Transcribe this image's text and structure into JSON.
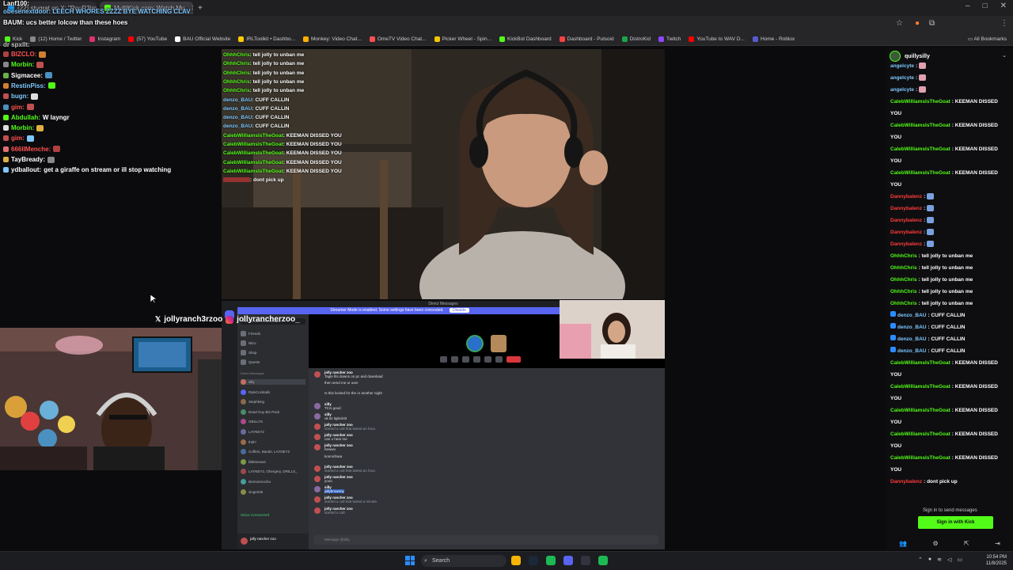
{
  "browser": {
    "tabs": [
      {
        "label": "(22) stugrat on X: \"RouR3im h",
        "color": "#1d9bf0"
      },
      {
        "label": "MultiKick.com: Watch Mu",
        "color": "#53fc18"
      }
    ],
    "new_tab": "+",
    "window_controls": [
      "–",
      "□",
      "✕"
    ],
    "bookmarks": [
      {
        "label": "Kick",
        "color": "#53fc18"
      },
      {
        "label": "(12) Home / Twitter",
        "color": "#888888"
      },
      {
        "label": "Instagram",
        "color": "#e1306c"
      },
      {
        "label": "(57) YouTube",
        "color": "#ff0000"
      },
      {
        "label": "BAU Official Website",
        "color": "#ffffff"
      },
      {
        "label": "IRLToolkit • Dashbo...",
        "color": "#ffcc00"
      },
      {
        "label": "Monkey: Video Chat...",
        "color": "#ffb000"
      },
      {
        "label": "OmeTV Video Chat...",
        "color": "#ff5050"
      },
      {
        "label": "Picker Wheel - Spin...",
        "color": "#f5c400"
      },
      {
        "label": "KickBot Dashboard",
        "color": "#53fc18"
      },
      {
        "label": "Dashboard - Pulsoid",
        "color": "#ff4040"
      },
      {
        "label": "DistroKid",
        "color": "#1aa54b"
      },
      {
        "label": "Twitch",
        "color": "#9146ff"
      },
      {
        "label": "YouTube to WAV D...",
        "color": "#ff0000"
      },
      {
        "label": "Home - Roblox",
        "color": "#5a5ad0"
      }
    ],
    "all_bookmarks": "All Bookmarks"
  },
  "top_overlay": {
    "lines": [
      {
        "text": "Lanf100:",
        "color": "#ffffff"
      },
      {
        "text": "obesenextdoor: LEECH WHORES ZZZZ BYE WATCHING CLAV",
        "color": "#7ec8ff"
      },
      {
        "text": "BAUM: ucs better lolcow than these hoes",
        "color": "#ffffff"
      },
      {
        "text": "dr spxllt:",
        "color": "#c8c8c8"
      }
    ]
  },
  "left_chat": [
    {
      "user": "BIZCLO:",
      "color": "#ff5050",
      "text": ""
    },
    {
      "user": "Morbin:",
      "color": "#53fc18",
      "text": ""
    },
    {
      "user": "Sigmacee:",
      "color": "#ffffff",
      "text": ""
    },
    {
      "user": "RestinPiss:",
      "color": "#7ec8ff",
      "text": ""
    },
    {
      "user": "bugn:",
      "color": "#7ec8ff",
      "text": ""
    },
    {
      "user": "gim:",
      "color": "#ff5050",
      "text": ""
    },
    {
      "user": "Abdullah:",
      "color": "#53fc18",
      "text": "W layngr"
    },
    {
      "user": "Morbin:",
      "color": "#53fc18",
      "text": ""
    },
    {
      "user": "gim:",
      "color": "#ff5050",
      "text": ""
    },
    {
      "user": "666IIMenche:",
      "color": "#ff5050",
      "text": ""
    },
    {
      "user": "TayBready:",
      "color": "#ffffff",
      "text": ""
    },
    {
      "user": "ydballout:",
      "color": "#ffffff",
      "text": "get a giraffe on stream or ill stop watching"
    }
  ],
  "stream_chat": [
    {
      "user": "OhhhChris",
      "color": "#53fc18",
      "text": ": tell jolly to unban me"
    },
    {
      "user": "OhhhChris",
      "color": "#53fc18",
      "text": ": tell jolly to unban me"
    },
    {
      "user": "OhhhChris",
      "color": "#53fc18",
      "text": ": tell jolly to unban me"
    },
    {
      "user": "OhhhChris",
      "color": "#53fc18",
      "text": ": tell jolly to unban me"
    },
    {
      "user": "OhhhChris",
      "color": "#53fc18",
      "text": ": tell jolly to unban me"
    },
    {
      "user": "denzo_BAU",
      "color": "#7ec8ff",
      "text": ": CUFF CALLIN"
    },
    {
      "user": "denzo_BAU",
      "color": "#7ec8ff",
      "text": ": CUFF CALLIN"
    },
    {
      "user": "denzo_BAU",
      "color": "#7ec8ff",
      "text": ": CUFF CALLIN"
    },
    {
      "user": "denzo_BAU",
      "color": "#7ec8ff",
      "text": ": CUFF CALLIN"
    },
    {
      "user": "CalebWilliamsIsTheGoat",
      "color": "#53fc18",
      "text": ": KEEMAN DISSED YOU"
    },
    {
      "user": "CalebWilliamsIsTheGoat",
      "color": "#53fc18",
      "text": ": KEEMAN DISSED YOU"
    },
    {
      "user": "CalebWilliamsIsTheGoat",
      "color": "#53fc18",
      "text": ": KEEMAN DISSED YOU"
    },
    {
      "user": "CalebWilliamsIsTheGoat",
      "color": "#53fc18",
      "text": ": KEEMAN DISSED YOU"
    },
    {
      "user": "CalebWilliamsIsTheGoat",
      "color": "#53fc18",
      "text": ": KEEMAN DISSED YOU"
    },
    {
      "user": "",
      "color": "#ff3b3b",
      "text": ": dont pick up"
    }
  ],
  "discord": {
    "title": "Direct Messages",
    "banner": "Streamer Mode is enabled. Some settings have been concealed.",
    "banner_button": "Disable",
    "handle_x": "jollyranch3rzoo",
    "handle_ig": "jollyrancherzoo_",
    "search_placeholder": "Find or start a conversation",
    "sidebar": [
      "Friends",
      "Nitro",
      "Shop",
      "Quests"
    ],
    "dm_header": "Direct Messages",
    "dms": [
      "silly",
      "RyleCocktails",
      "Stephking",
      "Dead Guy Bin Pack",
      "GBILLY5",
      "LAYNEY2",
      "thdt?",
      "Cuffem, Bands, LAYNEY2",
      "bbbmeows",
      "LAYNEY2, Ghergery, DRILLS_",
      "Demonmocho",
      "singertok"
    ],
    "messages": [
      {
        "name": "jolly rancher zoo",
        "text": "Tagle fits downs on pc and download"
      },
      {
        "name": "",
        "text": "then send me ur user"
      },
      {
        "name": "",
        "text": "Is this locked for the or another night"
      },
      {
        "name": "silly",
        "text": "Tit is good"
      },
      {
        "name": "silly",
        "text": "ok its tiglecktit"
      },
      {
        "name": "jolly rancher zoo",
        "text": "started a call that lasted an hour."
      },
      {
        "name": "jolly rancher zoo",
        "text": "can u hear me"
      },
      {
        "name": "jolly rancher zoo",
        "text": "hewwo"
      },
      {
        "name": "",
        "text": "konnichiwa"
      },
      {
        "name": "jolly rancher zoo",
        "text": "started a call that lasted an hour."
      },
      {
        "name": "jolly rancher zoo",
        "text": "yooo"
      },
      {
        "name": "silly",
        "text": "jollybrownny"
      },
      {
        "name": "jolly rancher zoo",
        "text": "started a call that lasted a minute."
      },
      {
        "name": "jolly rancher zoo",
        "text": "started a call."
      }
    ],
    "user_name": "jolly rancher zoo",
    "voice_status": "Voice Connected",
    "message_placeholder": "Message @silly"
  },
  "right_chat": {
    "streamer": "quillysilly",
    "messages": [
      {
        "user": "angelcyte",
        "color": "#7ec8ff",
        "text": ""
      },
      {
        "user": "angelcyte",
        "color": "#7ec8ff",
        "text": ""
      },
      {
        "user": "angelcyte",
        "color": "#7ec8ff",
        "text": ""
      },
      {
        "user": "CalebWilliamsIsTheGoat",
        "color": "#53fc18",
        "text": "KEEMAN DISSED YOU"
      },
      {
        "user": "CalebWilliamsIsTheGoat",
        "color": "#53fc18",
        "text": "KEEMAN DISSED YOU"
      },
      {
        "user": "CalebWilliamsIsTheGoat",
        "color": "#53fc18",
        "text": "KEEMAN DISSED YOU"
      },
      {
        "user": "CalebWilliamsIsTheGoat",
        "color": "#53fc18",
        "text": "KEEMAN DISSED YOU"
      },
      {
        "user": "Dannybalenz",
        "color": "#ff3b3b",
        "text": ""
      },
      {
        "user": "Dannybalenz",
        "color": "#ff3b3b",
        "text": ""
      },
      {
        "user": "Dannybalenz",
        "color": "#ff3b3b",
        "text": ""
      },
      {
        "user": "Dannybalenz",
        "color": "#ff3b3b",
        "text": ""
      },
      {
        "user": "Dannybalenz",
        "color": "#ff3b3b",
        "text": ""
      },
      {
        "user": "OhhhChris",
        "color": "#53fc18",
        "text": "tell jolly to unban me"
      },
      {
        "user": "OhhhChris",
        "color": "#53fc18",
        "text": "tell jolly to unban me"
      },
      {
        "user": "OhhhChris",
        "color": "#53fc18",
        "text": "tell jolly to unban me"
      },
      {
        "user": "OhhhChris",
        "color": "#53fc18",
        "text": "tell jolly to unban me"
      },
      {
        "user": "OhhhChris",
        "color": "#53fc18",
        "text": "tell jolly to unban me"
      },
      {
        "user": "denzo_BAU",
        "color": "#7ec8ff",
        "text": "CUFF CALLIN"
      },
      {
        "user": "denzo_BAU",
        "color": "#7ec8ff",
        "text": "CUFF CALLIN"
      },
      {
        "user": "denzo_BAU",
        "color": "#7ec8ff",
        "text": "CUFF CALLIN"
      },
      {
        "user": "denzo_BAU",
        "color": "#7ec8ff",
        "text": "CUFF CALLIN"
      },
      {
        "user": "CalebWilliamsIsTheGoat",
        "color": "#53fc18",
        "text": "KEEMAN DISSED YOU"
      },
      {
        "user": "CalebWilliamsIsTheGoat",
        "color": "#53fc18",
        "text": "KEEMAN DISSED YOU"
      },
      {
        "user": "CalebWilliamsIsTheGoat",
        "color": "#53fc18",
        "text": "KEEMAN DISSED YOU"
      },
      {
        "user": "CalebWilliamsIsTheGoat",
        "color": "#53fc18",
        "text": "KEEMAN DISSED YOU"
      },
      {
        "user": "CalebWilliamsIsTheGoat",
        "color": "#53fc18",
        "text": "KEEMAN DISSED YOU"
      },
      {
        "user": "Dannybalenz",
        "color": "#ff3b3b",
        "text": "dont pick up"
      }
    ],
    "sign_in_label": "Sign in to send messages",
    "sign_in_button": "Sign in with Kick"
  },
  "taskbar": {
    "search": "Search",
    "time": "10:54 PM",
    "date": "11/8/2025",
    "apps": [
      {
        "name": "chrome-icon",
        "color": "#f4b400"
      },
      {
        "name": "steam-icon",
        "color": "#1b2838"
      },
      {
        "name": "app-green-icon",
        "color": "#1db954"
      },
      {
        "name": "discord-icon",
        "color": "#5865f2"
      },
      {
        "name": "obs-icon",
        "color": "#333340"
      },
      {
        "name": "spotify-icon",
        "color": "#1db954"
      }
    ]
  },
  "colors": {
    "kick_green": "#53fc18",
    "discord_blurple": "#5865f2",
    "call_red": "#da373c"
  }
}
